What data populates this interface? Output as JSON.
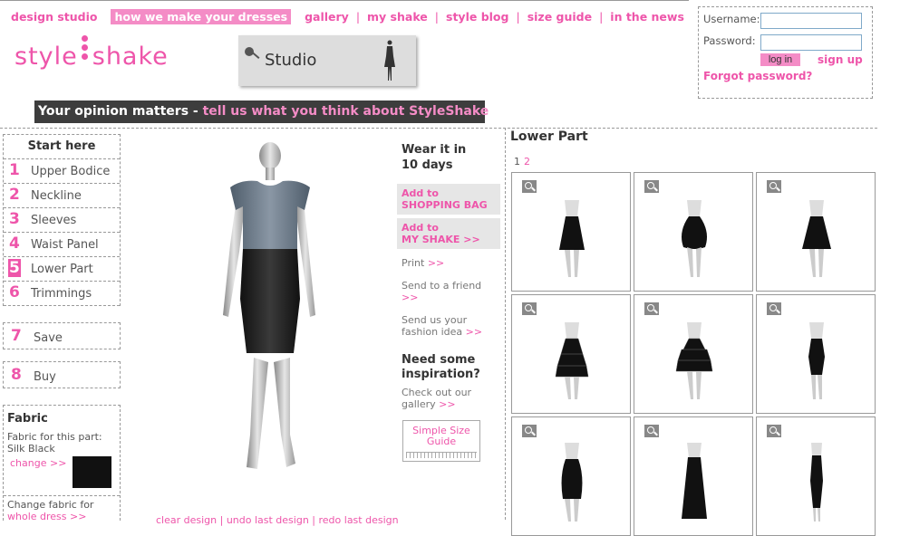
{
  "nav": {
    "items": [
      "design studio",
      "how we make your dresses",
      "gallery",
      "my shake",
      "style blog",
      "size guide",
      "in the news"
    ],
    "active_index": 1
  },
  "logo": {
    "left": "style",
    "right": "shake"
  },
  "studio": {
    "label": "Studio"
  },
  "login": {
    "username_label": "Username:",
    "password_label": "Password:",
    "username_value": "",
    "password_value": "",
    "login_button": "log in",
    "signup": "sign up",
    "forgot": "Forgot password?"
  },
  "opinion": {
    "lead": "Your opinion matters - ",
    "link": "tell us what you think about StyleShake"
  },
  "steps": {
    "header": "Start here",
    "items": [
      {
        "num": "1",
        "label": "Upper Bodice"
      },
      {
        "num": "2",
        "label": "Neckline"
      },
      {
        "num": "3",
        "label": "Sleeves"
      },
      {
        "num": "4",
        "label": "Waist Panel"
      },
      {
        "num": "5",
        "label": "Lower Part"
      },
      {
        "num": "6",
        "label": "Trimmings"
      }
    ],
    "selected_index": 4,
    "save": {
      "num": "7",
      "label": "Save"
    },
    "buy": {
      "num": "8",
      "label": "Buy"
    }
  },
  "fabric": {
    "title": "Fabric",
    "for_part": "Fabric for this part:",
    "name": "Silk Black",
    "change": "change >>",
    "change_for": "Change fabric for",
    "whole_dress": "whole dress >>"
  },
  "bottom_links": "clear design  |  undo last design  |  redo last design",
  "actions": {
    "wear_line1": "Wear it in",
    "wear_line2": "10 days",
    "add_bag_1": "Add to",
    "add_bag_2": "SHOPPING BAG",
    "add_shake_1": "Add to",
    "add_shake_2": "MY SHAKE >>",
    "print": "Print",
    "send_friend": "Send to a friend",
    "send_idea_1": "Send us your",
    "send_idea_2": "fashion idea",
    "arrow": ">>",
    "need_1": "Need some",
    "need_2": "inspiration?",
    "check_1": "Check out our",
    "check_2": "gallery",
    "size_guide_1": "Simple Size",
    "size_guide_2": "Guide"
  },
  "panel": {
    "title": "Lower Part",
    "page1": "1",
    "page2": "2",
    "items": [
      "skirt-a",
      "skirt-bubble",
      "skirt-flared",
      "skirt-tiered",
      "skirt-ruffled",
      "skirt-pencil",
      "skirt-tulip",
      "skirt-maxi",
      "skirt-long-pencil"
    ]
  },
  "colors": {
    "accent": "#ee55aa",
    "accent_light": "#f48cc6",
    "dark_bar": "#3d3d3d"
  }
}
